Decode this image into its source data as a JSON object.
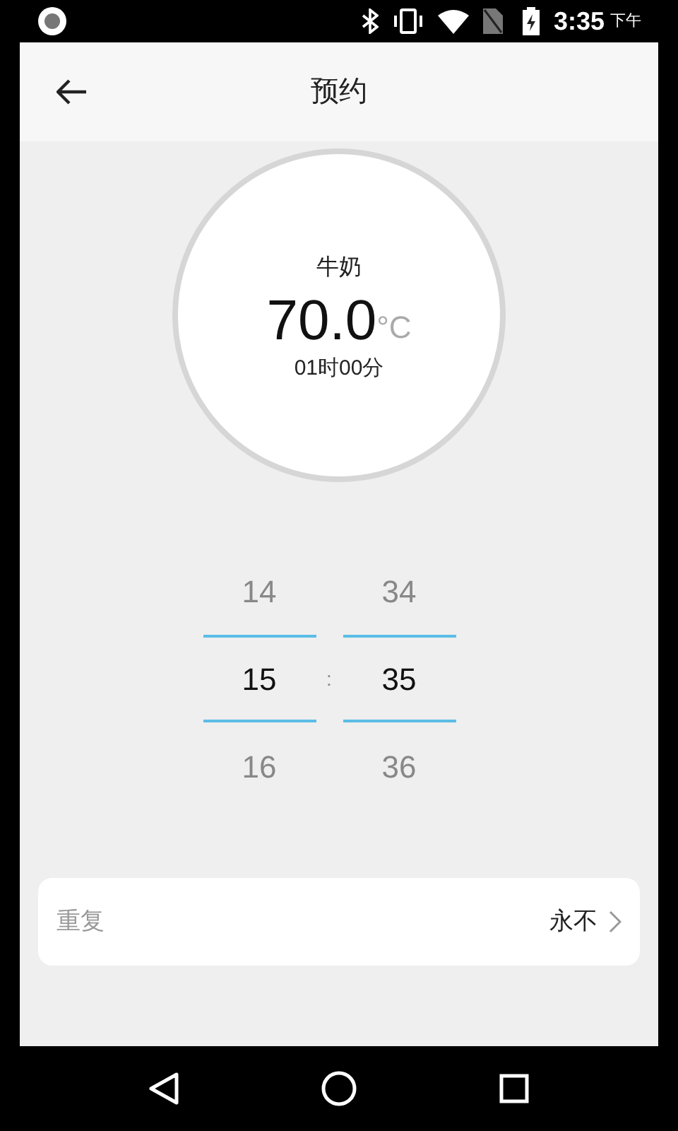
{
  "status_bar": {
    "time": "3:35",
    "period": "下午"
  },
  "app_bar": {
    "title": "预约"
  },
  "dial": {
    "name": "牛奶",
    "temperature": "70.0",
    "unit": "°C",
    "duration": "01时00分"
  },
  "time_picker": {
    "separator": ":",
    "columns": [
      {
        "items": [
          {
            "label": "14",
            "selected": false
          },
          {
            "label": "15",
            "selected": true
          },
          {
            "label": "16",
            "selected": false
          }
        ]
      },
      {
        "items": [
          {
            "label": "34",
            "selected": false
          },
          {
            "label": "35",
            "selected": true
          },
          {
            "label": "36",
            "selected": false
          }
        ]
      }
    ]
  },
  "repeat": {
    "label": "重复",
    "value": "永不"
  }
}
